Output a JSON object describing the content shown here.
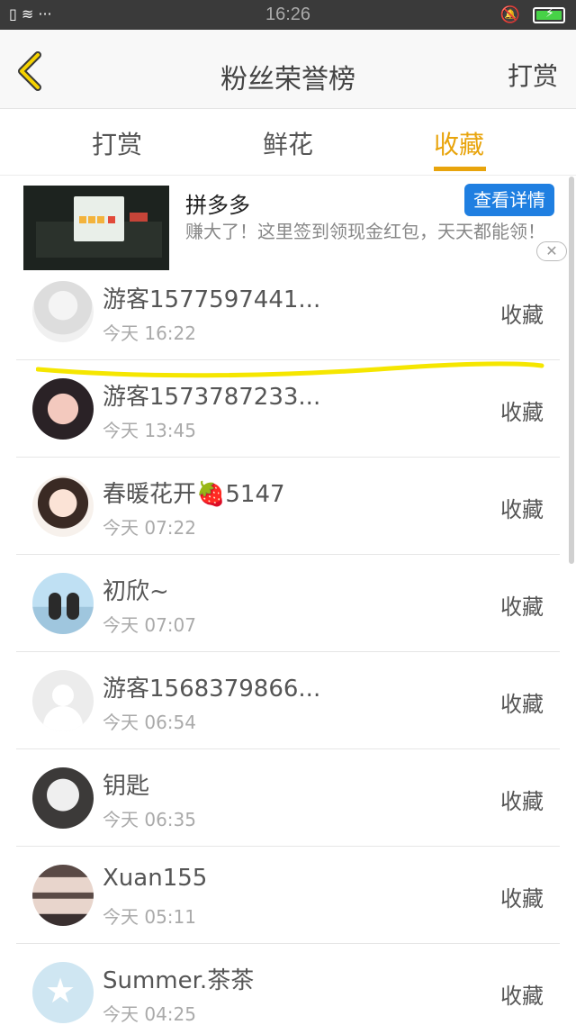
{
  "status_bar": {
    "time": "16:26",
    "left_icons": "▯ ≋ ···"
  },
  "header": {
    "title": "粉丝荣誉榜",
    "right_label": "打赏"
  },
  "tabs": [
    {
      "label": "打赏"
    },
    {
      "label": "鲜花"
    },
    {
      "label": "收藏"
    }
  ],
  "ad": {
    "name": "拼多多",
    "description": "赚大了！这里签到领现金红包，天天都能领！",
    "button": "查看详情",
    "close": "✕"
  },
  "list": [
    {
      "name": "游客1577597441...",
      "time": "今天 16:22",
      "action": "收藏"
    },
    {
      "name": "游客1573787233...",
      "time": "今天 13:45",
      "action": "收藏"
    },
    {
      "name": "春暖花开🍓5147",
      "time": "今天 07:22",
      "action": "收藏"
    },
    {
      "name": "初欣~",
      "time": "今天 07:07",
      "action": "收藏"
    },
    {
      "name": "游客1568379866...",
      "time": "今天 06:54",
      "action": "收藏"
    },
    {
      "name": "钥匙",
      "time": "今天 06:35",
      "action": "收藏"
    },
    {
      "name": "Xuan155",
      "time": "今天 05:11",
      "action": "收藏"
    },
    {
      "name": "Summer.茶茶",
      "time": "今天 04:25",
      "action": "收藏"
    }
  ],
  "colors": {
    "accent": "#e8a40c",
    "ad_button": "#1f7fe1",
    "highlight": "#f5e600"
  }
}
